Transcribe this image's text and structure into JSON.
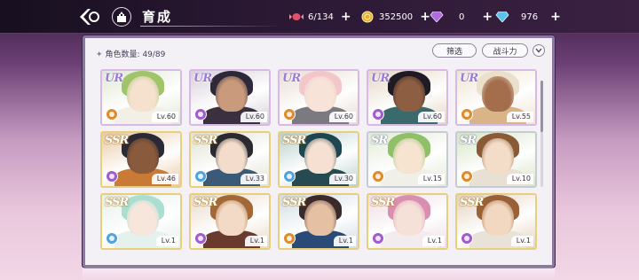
{
  "header": {
    "title": "育成"
  },
  "resources": [
    {
      "name": "candy-icon",
      "value": "6/134",
      "color": "#e0506a"
    },
    {
      "name": "coin-icon",
      "value": "352500",
      "color": "#e8b02a"
    },
    {
      "name": "purple-gem-icon",
      "value": "0",
      "color": "#b46be0"
    },
    {
      "name": "blue-gem-icon",
      "value": "976",
      "color": "#5bc2ee"
    }
  ],
  "panel": {
    "count_label": "角色数量: 49/89",
    "filter_label": "筛选",
    "sort_label": "战斗力"
  },
  "cards": [
    {
      "rarity": "UR",
      "level": "Lv.60",
      "attr_color": "#e08a2a",
      "hair": "#9fc46a",
      "skin": "#f6e1cf",
      "bg": "#dfe8d4",
      "outfit": "#f2efe6"
    },
    {
      "rarity": "UR",
      "level": "Lv.60",
      "attr_color": "#a05bd0",
      "hair": "#2e2838",
      "skin": "#c99a7c",
      "bg": "#d7cfd8",
      "outfit": "#3a3040"
    },
    {
      "rarity": "UR",
      "level": "Lv.60",
      "attr_color": "#e08a2a",
      "hair": "#f3c7c9",
      "skin": "#f7e3d8",
      "bg": "#e7dcd4",
      "outfit": "#7a7a80"
    },
    {
      "rarity": "UR",
      "level": "Lv.60",
      "attr_color": "#a05bd0",
      "hair": "#1f1a24",
      "skin": "#8d5e42",
      "bg": "#e3d6c4",
      "outfit": "#3b6a6c"
    },
    {
      "rarity": "UR",
      "level": "Lv.55",
      "attr_color": "#e08a2a",
      "hair": "#ebe0cc",
      "skin": "#a46e4c",
      "bg": "#efe4d2",
      "outfit": "#d8b488"
    },
    {
      "rarity": "SSR",
      "level": "Lv.46",
      "attr_color": "#a05bd0",
      "hair": "#2a2a36",
      "skin": "#8a5a3c",
      "bg": "#e9c9a6",
      "outfit": "#c97a36"
    },
    {
      "rarity": "SSR",
      "level": "Lv.33",
      "attr_color": "#4fa3e0",
      "hair": "#2a2a30",
      "skin": "#f3dccb",
      "bg": "#dfe2d2",
      "outfit": "#3a5a78"
    },
    {
      "rarity": "SSR",
      "level": "Lv.30",
      "attr_color": "#4fa3e0",
      "hair": "#1e4650",
      "skin": "#f6e0d2",
      "bg": "#b9d0cc",
      "outfit": "#274a52"
    },
    {
      "rarity": "SR",
      "level": "Lv.15",
      "attr_color": "#e08a2a",
      "hair": "#8ec067",
      "skin": "#f6e3d0",
      "bg": "#e2ead6",
      "outfit": "#f0efe8"
    },
    {
      "rarity": "SR",
      "level": "Lv.10",
      "attr_color": "#e08a2a",
      "hair": "#8a5a36",
      "skin": "#f4ddc8",
      "bg": "#d6e4c6",
      "outfit": "#e8e0d2"
    },
    {
      "rarity": "SSR",
      "level": "Lv.1",
      "attr_color": "#4fa3e0",
      "hair": "#a9ded0",
      "skin": "#f7e6dc",
      "bg": "#e7f0ea",
      "outfit": "#e4f1ec"
    },
    {
      "rarity": "SSR",
      "level": "Lv.1",
      "attr_color": "#a05bd0",
      "hair": "#a46836",
      "skin": "#f3dac6",
      "bg": "#e8d9c8",
      "outfit": "#6b3a2e"
    },
    {
      "rarity": "SSR",
      "level": "Lv.1",
      "attr_color": "#e08a2a",
      "hair": "#3a2a2a",
      "skin": "#e6c0a2",
      "bg": "#cfdce4",
      "outfit": "#2a4a78"
    },
    {
      "rarity": "SSR",
      "level": "Lv.1",
      "attr_color": "#a05bd0",
      "hair": "#d98fb0",
      "skin": "#f6e1d8",
      "bg": "#efdde4",
      "outfit": "#f2ecee"
    },
    {
      "rarity": "SSR",
      "level": "Lv.1",
      "attr_color": "#a05bd0",
      "hair": "#9a6038",
      "skin": "#f2d8c0",
      "bg": "#e3d2bd",
      "outfit": "#e9e2d8"
    }
  ]
}
